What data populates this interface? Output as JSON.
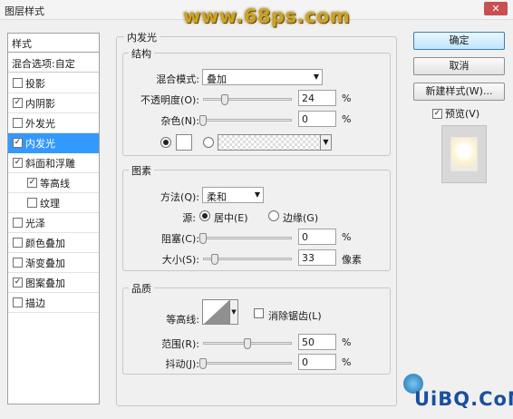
{
  "window": {
    "title": "图层样式",
    "close": "✕",
    "watermark": "www.68ps.com"
  },
  "style_list": {
    "header": "样式",
    "blend": "混合选项:自定",
    "items": [
      {
        "label": "投影",
        "checked": false,
        "mark": ""
      },
      {
        "label": "内阴影",
        "checked": true,
        "mark": "✓"
      },
      {
        "label": "外发光",
        "checked": false,
        "mark": ""
      },
      {
        "label": "内发光",
        "checked": true,
        "mark": "✓",
        "selected": true
      },
      {
        "label": "斜面和浮雕",
        "checked": true,
        "mark": "✓"
      },
      {
        "label": "等高线",
        "checked": true,
        "mark": "✓",
        "sub": true
      },
      {
        "label": "纹理",
        "checked": false,
        "mark": "",
        "sub": true
      },
      {
        "label": "光泽",
        "checked": false,
        "mark": ""
      },
      {
        "label": "颜色叠加",
        "checked": false,
        "mark": ""
      },
      {
        "label": "渐变叠加",
        "checked": false,
        "mark": ""
      },
      {
        "label": "图案叠加",
        "checked": true,
        "mark": "✓"
      },
      {
        "label": "描边",
        "checked": false,
        "mark": ""
      }
    ]
  },
  "inner_glow": {
    "title": "内发光",
    "structure": {
      "title": "结构",
      "blend_mode_label": "混合模式:",
      "blend_mode_value": "叠加",
      "opacity_label": "不透明度(O):",
      "opacity_value": "24",
      "opacity_fraction": 0.24,
      "noise_label": "杂色(N):",
      "noise_value": "0",
      "noise_fraction": 0,
      "percent": "%"
    },
    "elements": {
      "title": "图素",
      "method_label": "方法(Q):",
      "method_value": "柔和",
      "source_label": "源:",
      "source_center": "居中(E)",
      "source_edge": "边缘(G)",
      "choke_label": "阻塞(C):",
      "choke_value": "0",
      "choke_fraction": 0,
      "size_label": "大小(S):",
      "size_value": "33",
      "size_fraction": 0.133,
      "size_unit": "像素",
      "percent": "%"
    },
    "quality": {
      "title": "品质",
      "contour_label": "等高线:",
      "antialias_label": "消除锯齿(L)",
      "range_label": "范围(R):",
      "range_value": "50",
      "range_fraction": 0.5,
      "jitter_label": "抖动(J):",
      "jitter_value": "0",
      "jitter_fraction": 0,
      "percent": "%"
    }
  },
  "buttons": {
    "ok": "确定",
    "cancel": "取消",
    "new_style": "新建样式(W)...",
    "preview_label": "预览(V)",
    "preview_mark": "✓"
  },
  "footer_watermark": "UiBQ.CoM"
}
